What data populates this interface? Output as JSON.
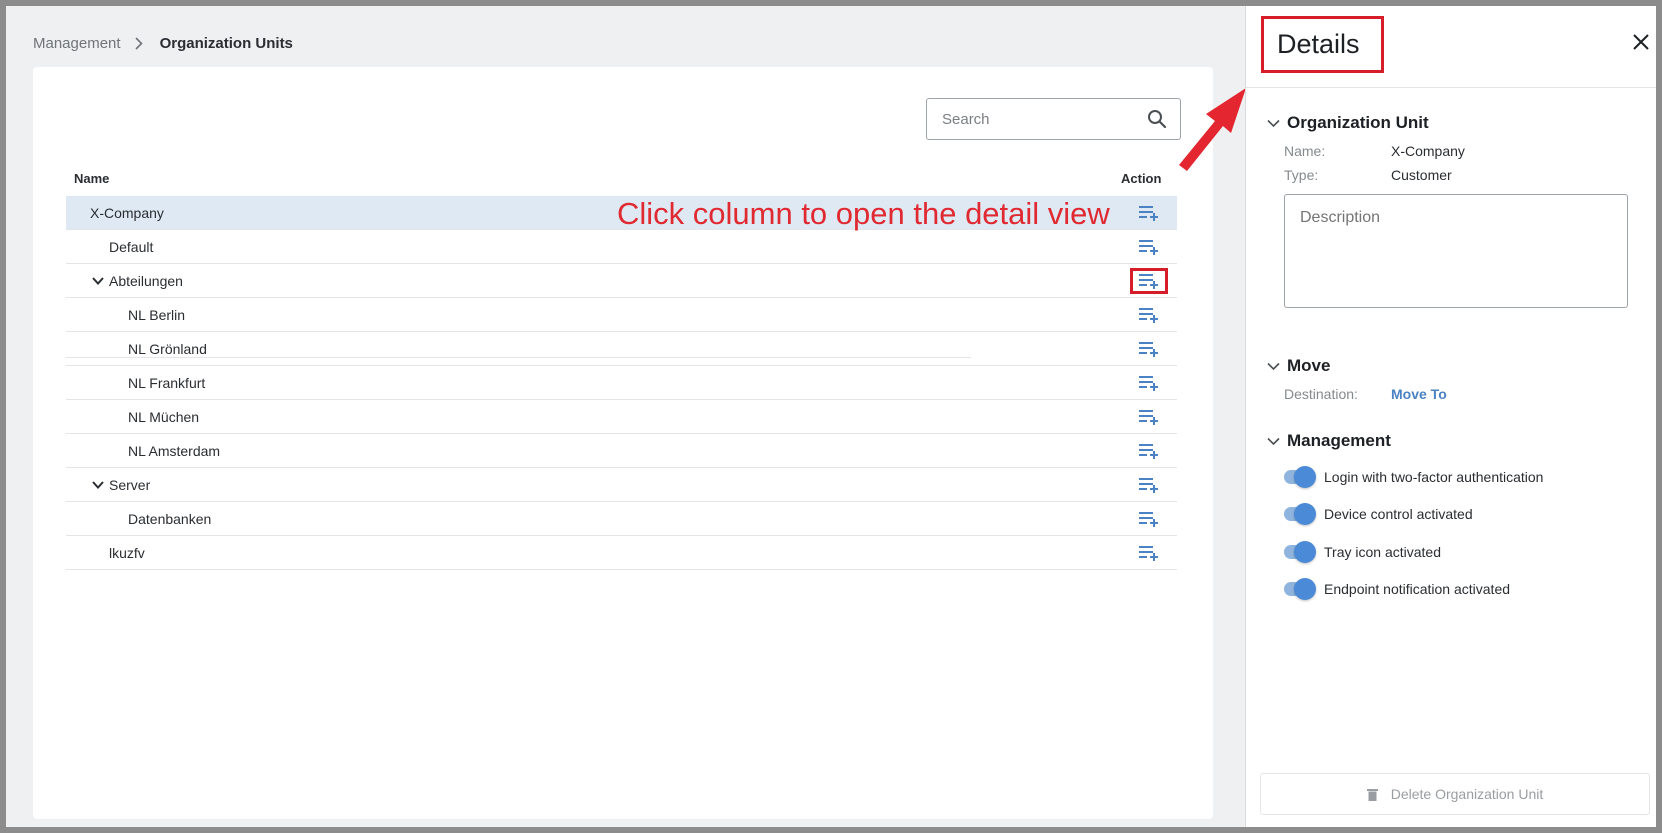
{
  "breadcrumb": {
    "parent": "Management",
    "current": "Organization Units"
  },
  "search": {
    "placeholder": "Search"
  },
  "table": {
    "col_name": "Name",
    "col_action": "Action",
    "rows": [
      {
        "label": "X-Company",
        "level": 0,
        "expandable": false,
        "selected": true
      },
      {
        "label": "Default",
        "level": 1,
        "expandable": false
      },
      {
        "label": "Abteilungen",
        "level": 1,
        "expandable": true,
        "expanded": true,
        "action_highlighted": true
      },
      {
        "label": "NL Berlin",
        "level": 2,
        "expandable": false
      },
      {
        "label": "NL Grönland",
        "level": 2,
        "expandable": false
      },
      {
        "label": "NL Frankfurt",
        "level": 2,
        "expandable": false
      },
      {
        "label": "NL Müchen",
        "level": 2,
        "expandable": false
      },
      {
        "label": "NL Amsterdam",
        "level": 2,
        "expandable": false
      },
      {
        "label": "Server",
        "level": 1,
        "expandable": true,
        "expanded": true
      },
      {
        "label": "Datenbanken",
        "level": 2,
        "expandable": false
      },
      {
        "label": "lkuzfv",
        "level": 1,
        "expandable": false
      }
    ]
  },
  "annotation": "Click column to open the detail view",
  "details": {
    "title": "Details",
    "org_unit": {
      "heading": "Organization Unit",
      "name_label": "Name:",
      "name_value": "X-Company",
      "type_label": "Type:",
      "type_value": "Customer",
      "description_placeholder": "Description"
    },
    "move": {
      "heading": "Move",
      "destination_label": "Destination:",
      "destination_link": "Move To"
    },
    "management": {
      "heading": "Management",
      "toggles": [
        {
          "label": "Login with two-factor authentication",
          "on": true
        },
        {
          "label": "Device control activated",
          "on": true
        },
        {
          "label": "Tray icon activated",
          "on": true
        },
        {
          "label": "Endpoint notification activated",
          "on": true
        }
      ]
    },
    "delete_label": "Delete Organization Unit"
  },
  "colors": {
    "accent": "#4a82c3",
    "annotation": "#e02a32",
    "highlight_border": "#d51e29",
    "selected_row": "#dfe9f3"
  }
}
